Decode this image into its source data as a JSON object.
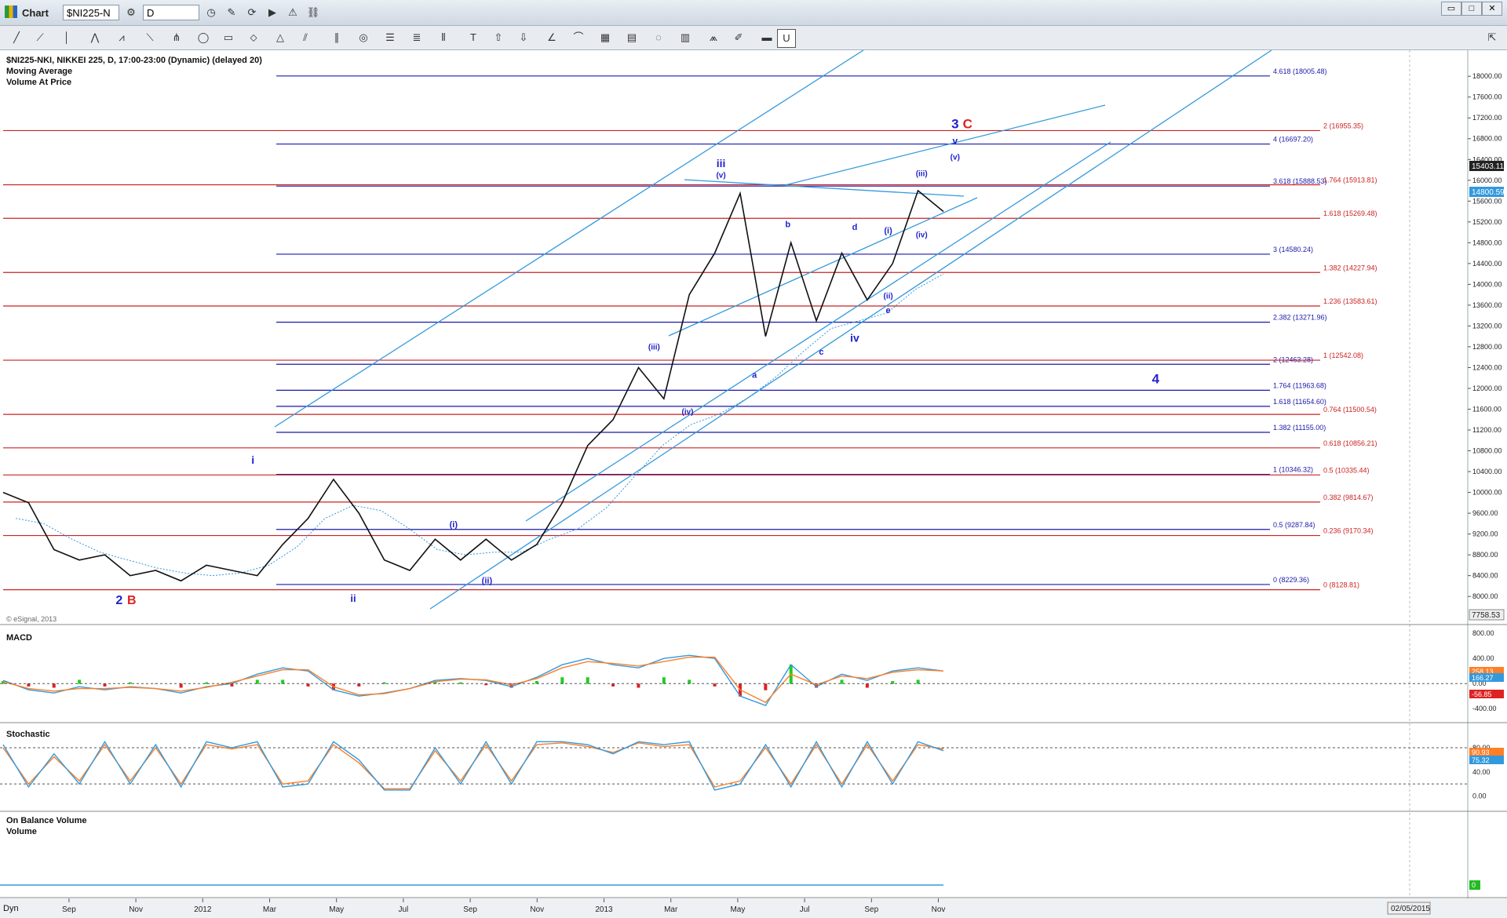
{
  "window": {
    "title": "Chart",
    "symbol": "$NI225-N",
    "interval": "D",
    "date_box": "02/05/2015"
  },
  "chart_header": {
    "line1": "$NI225-NKI, NIKKEI 225, D, 17:00-23:00 (Dynamic) (delayed 20)",
    "line2": "Moving Average",
    "line3": "Volume At Price",
    "watermark": "© eSignal, 2013"
  },
  "panels": {
    "macd": "MACD",
    "stochastic": "Stochastic",
    "obv1": "On Balance Volume",
    "obv2": "Volume"
  },
  "colors": {
    "price": "#111111",
    "ma": "#3399dd",
    "channel": "#3399dd",
    "blue_fib": "#1a1aaa",
    "red_fib": "#cc2222",
    "macd_line": "#3399dd",
    "signal_line": "#ff7f27",
    "hist_pos": "#22cc22",
    "hist_neg": "#dd2222"
  },
  "chart_data": {
    "type": "line",
    "series": [
      {
        "name": "Moving Average",
        "y": [
          9500,
          9400,
          9100,
          8850,
          8700,
          8550,
          8450,
          8400,
          8450,
          8600,
          8950,
          9500,
          9750,
          9650,
          9300,
          8900,
          8800,
          8850,
          8850,
          9100,
          9300,
          9700,
          10300,
          10900,
          11300,
          11500,
          11800,
          12200,
          12700,
          13150,
          13300,
          13450,
          13900,
          14200
        ]
      },
      {
        "name": "Price",
        "y": [
          10000,
          9800,
          8900,
          8700,
          8800,
          8400,
          8500,
          8300,
          8600,
          8500,
          8400,
          9000,
          9500,
          10250,
          9600,
          8700,
          8500,
          9100,
          8700,
          9100,
          8700,
          9000,
          9800,
          10900,
          11400,
          12400,
          11800,
          13800,
          14600,
          15750,
          13000,
          14800,
          13300,
          14600,
          13700,
          14400,
          15800,
          15400
        ]
      }
    ],
    "dates": [
      "Aug 2011",
      "Aug 2011",
      "Sep 2011",
      "Sep 2011",
      "Oct 2011",
      "Nov 2011",
      "Nov 2011",
      "Nov 2011",
      "Dec 2011",
      "Jan 2012",
      "Jan 2012",
      "Feb 2012",
      "Feb 2012",
      "Mar 2012",
      "Apr 2012",
      "May 2012",
      "Jun 2012",
      "Jul 2012",
      "Aug 2012",
      "Sep 2012",
      "Oct 2012",
      "Nov 2012",
      "Dec 2012",
      "Jan 2013",
      "Feb 2013",
      "Mar 2013",
      "Apr 2013",
      "Apr 2013",
      "May 2013",
      "May 2013",
      "Jun 2013",
      "Jul 2013",
      "Aug 2013",
      "Sep 2013",
      "Oct 2013",
      "Oct 2013",
      "Nov 2013",
      "Dec 2013"
    ],
    "price_ticks": [
      "18000.00",
      "17600.00",
      "17200.00",
      "16800.00",
      "16400.00",
      "16000.00",
      "15600.00",
      "15200.00",
      "14800.00",
      "14400.00",
      "14000.00",
      "13600.00",
      "13200.00",
      "12800.00",
      "12400.00",
      "12000.00",
      "11600.00",
      "11200.00",
      "10800.00",
      "10400.00",
      "10000.00",
      "9600.00",
      "9200.00",
      "8800.00",
      "8400.00",
      "8000.00"
    ],
    "price_tick_values": [
      18000,
      17600,
      17200,
      16800,
      16400,
      16000,
      15600,
      15200,
      14800,
      14400,
      14000,
      13600,
      13200,
      12800,
      12400,
      12000,
      11600,
      11200,
      10800,
      10400,
      10000,
      9600,
      9200,
      8800,
      8400,
      8000
    ],
    "ylim": [
      7550,
      18380
    ],
    "last_price_label": "15403.11",
    "ma_label": "14800.59",
    "bottom_label": "7758.53",
    "x_tick_labels": [
      "Sep",
      "Nov",
      "2012",
      "Mar",
      "May",
      "Jul",
      "Sep",
      "Nov",
      "2013",
      "Mar",
      "May",
      "Jul",
      "Sep",
      "Nov"
    ],
    "x_tick_dates": [
      "Sep 2011",
      "Nov 2011",
      "Jan 2012",
      "Mar 2012",
      "May 2012",
      "Jul 2012",
      "Sep 2012",
      "Nov 2012",
      "Jan 2013",
      "Mar 2013",
      "May 2013",
      "Jul 2013",
      "Sep 2013",
      "Nov 2013"
    ],
    "blue_fibs": [
      {
        "label": "4.618 (18005.48)",
        "value": 18005.48
      },
      {
        "label": "4 (16697.20)",
        "value": 16697.2
      },
      {
        "label": "3.618 (15888.53)",
        "value": 15888.53
      },
      {
        "label": "3 (14580.24)",
        "value": 14580.24
      },
      {
        "label": "2.382 (13271.96)",
        "value": 13271.96
      },
      {
        "label": "2 (12463.28)",
        "value": 12463.28
      },
      {
        "label": "1.764 (11963.68)",
        "value": 11963.68
      },
      {
        "label": "1.618 (11654.60)",
        "value": 11654.6
      },
      {
        "label": "1.382 (11155.00)",
        "value": 11155.0
      },
      {
        "label": "1 (10346.32)",
        "value": 10346.32
      },
      {
        "label": "0.5 (9287.84)",
        "value": 9287.84
      },
      {
        "label": "0 (8229.36)",
        "value": 8229.36
      }
    ],
    "red_fibs": [
      {
        "label": "2 (16955.35)",
        "value": 16955.35
      },
      {
        "label": "1.764 (15913.81)",
        "value": 15913.81
      },
      {
        "label": "1.618 (15269.48)",
        "value": 15269.48
      },
      {
        "label": "1.382 (14227.94)",
        "value": 14227.94
      },
      {
        "label": "1.236 (13583.61)",
        "value": 13583.61
      },
      {
        "label": "1 (12542.08)",
        "value": 12542.08
      },
      {
        "label": "0.764 (11500.54)",
        "value": 11500.54
      },
      {
        "label": "0.618 (10856.21)",
        "value": 10856.21
      },
      {
        "label": "0.5 (10335.44)",
        "value": 10335.44
      },
      {
        "label": "0.382 (9814.67)",
        "value": 9814.67
      },
      {
        "label": "0.236 (9170.34)",
        "value": 9170.34
      },
      {
        "label": "0 (8128.81)",
        "value": 8128.81
      }
    ],
    "wave_labels": [
      {
        "text": "2",
        "date": "Nov 2011",
        "value": 7850,
        "color": "#2222cc",
        "size": 16
      },
      {
        "text": "B",
        "date": "Nov 2011",
        "value": 7850,
        "color": "#dd2222",
        "size": 16,
        "dx": 16
      },
      {
        "text": "i",
        "date": "Mar 2012",
        "value": 10550,
        "color": "#2222cc",
        "size": 14
      },
      {
        "text": "ii",
        "date": "Jun 2012",
        "value": 7900,
        "color": "#2222cc",
        "size": 13
      },
      {
        "text": "(i)",
        "date": "Sep 2012",
        "value": 9330,
        "color": "#2222cc",
        "size": 11
      },
      {
        "text": "(ii)",
        "date": "Oct 2012",
        "value": 8250,
        "color": "#2222cc",
        "size": 11
      },
      {
        "text": "(iii)",
        "date": "Mar 2013",
        "value": 12750,
        "color": "#2222cc",
        "size": 10
      },
      {
        "text": "(iv)",
        "date": "Apr 2013",
        "value": 11500,
        "color": "#2222cc",
        "size": 10
      },
      {
        "text": "iii",
        "date": "May 2013",
        "value": 16250,
        "color": "#2222cc",
        "size": 14
      },
      {
        "text": "(v)",
        "date": "May 2013",
        "value": 16050,
        "color": "#2222cc",
        "size": 10
      },
      {
        "text": "a",
        "date": "Jun 2013",
        "value": 12200,
        "color": "#2222cc",
        "size": 11
      },
      {
        "text": "b",
        "date": "Jul 2013",
        "value": 15100,
        "color": "#2222cc",
        "size": 11
      },
      {
        "text": "c",
        "date": "Aug 2013",
        "value": 12650,
        "color": "#2222cc",
        "size": 11
      },
      {
        "text": "d",
        "date": "Sep 2013",
        "value": 15050,
        "color": "#2222cc",
        "size": 11
      },
      {
        "text": "e",
        "date": "Oct 2013",
        "value": 13450,
        "color": "#2222cc",
        "size": 11
      },
      {
        "text": "iv",
        "date": "Sep 2013",
        "value": 12900,
        "color": "#2222cc",
        "size": 14
      },
      {
        "text": "(i)",
        "date": "Oct 2013",
        "value": 14980,
        "color": "#2222cc",
        "size": 11
      },
      {
        "text": "(ii)",
        "date": "Oct 2013",
        "value": 13730,
        "color": "#2222cc",
        "size": 10
      },
      {
        "text": "(iii)",
        "date": "Nov 2013",
        "value": 16080,
        "color": "#2222cc",
        "size": 10
      },
      {
        "text": "(iv)",
        "date": "Nov 2013",
        "value": 14900,
        "color": "#2222cc",
        "size": 10
      },
      {
        "text": "(v)",
        "date": "Dec 2013",
        "value": 16400,
        "color": "#2222cc",
        "size": 10
      },
      {
        "text": "v",
        "date": "Dec 2013",
        "value": 16700,
        "color": "#2222cc",
        "size": 12
      },
      {
        "text": "3",
        "date": "Dec 2013",
        "value": 17000,
        "color": "#2222cc",
        "size": 17
      },
      {
        "text": "C",
        "date": "Dec 2013",
        "value": 17000,
        "color": "#dd2222",
        "size": 17,
        "dx": 16
      },
      {
        "text": "4",
        "date": "Jun 2014",
        "value": 12100,
        "color": "#2222cc",
        "size": 17
      }
    ],
    "macd": {
      "ticks": [
        "800.00",
        "400.00",
        "0.00",
        "-400.00"
      ],
      "tick_values": [
        800,
        400,
        0,
        -400
      ],
      "ylim": [
        -560,
        840
      ],
      "macd_y": [
        50,
        -100,
        -150,
        -50,
        -100,
        -50,
        -80,
        -150,
        -50,
        0,
        150,
        250,
        200,
        -100,
        -200,
        -150,
        -80,
        50,
        80,
        50,
        -50,
        100,
        300,
        400,
        300,
        250,
        400,
        450,
        400,
        -200,
        -350,
        300,
        -50,
        150,
        50,
        200,
        250,
        200
      ],
      "signal_y": [
        30,
        -80,
        -120,
        -80,
        -80,
        -60,
        -80,
        -120,
        -60,
        20,
        120,
        220,
        220,
        -50,
        -180,
        -160,
        -80,
        30,
        70,
        60,
        -20,
        80,
        250,
        350,
        320,
        280,
        350,
        420,
        420,
        -100,
        -300,
        150,
        -20,
        120,
        80,
        180,
        220,
        200
      ],
      "labels": [
        "258.13",
        "166.27",
        "-56.85"
      ]
    },
    "stochastic": {
      "ticks": [
        "80.00",
        "40.00",
        "0.00"
      ],
      "tick_values": [
        80,
        40,
        0
      ],
      "ylim": [
        -20,
        115
      ],
      "k_y": [
        85,
        15,
        70,
        20,
        90,
        20,
        85,
        15,
        90,
        80,
        90,
        15,
        20,
        90,
        60,
        10,
        10,
        80,
        20,
        90,
        20,
        90,
        90,
        85,
        70,
        90,
        85,
        90,
        10,
        20,
        85,
        15,
        90,
        15,
        90,
        20,
        90,
        75
      ],
      "d_y": [
        80,
        20,
        65,
        25,
        85,
        25,
        80,
        20,
        85,
        78,
        85,
        20,
        25,
        85,
        55,
        12,
        12,
        75,
        25,
        85,
        25,
        85,
        88,
        82,
        72,
        88,
        82,
        85,
        15,
        25,
        80,
        20,
        85,
        20,
        85,
        25,
        85,
        78
      ],
      "labels": [
        "90.93",
        "75.32"
      ],
      "upper": 80,
      "lower": 20
    },
    "obv": {
      "value_label": "0"
    }
  }
}
